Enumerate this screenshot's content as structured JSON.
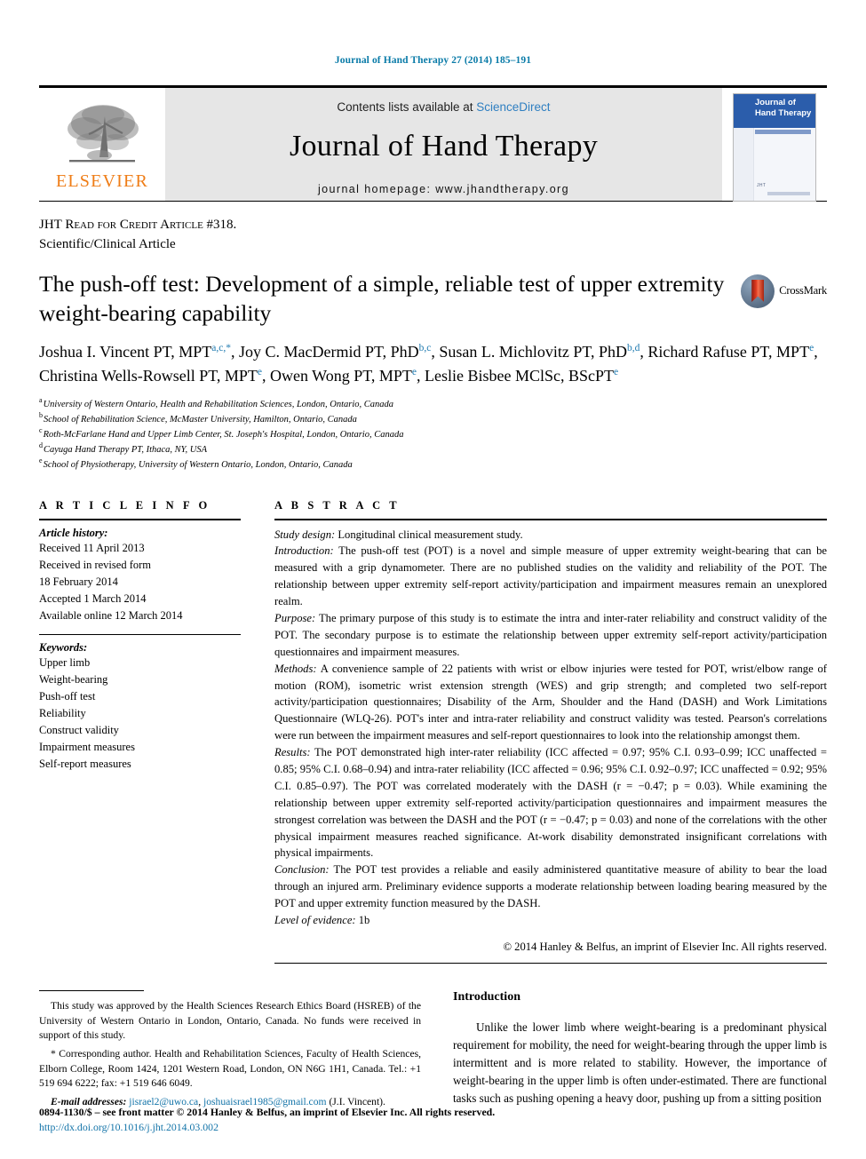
{
  "running_head": "Journal of Hand Therapy 27 (2014) 185–191",
  "masthead": {
    "publisher_name": "ELSEVIER",
    "contents_prefix": "Contents lists available at",
    "sciencedirect": "ScienceDirect",
    "journal_name": "Journal of Hand Therapy",
    "homepage": "journal homepage: www.jhandtherapy.org",
    "cover": {
      "title_line1": "Journal of",
      "title_line2": "Hand Therapy",
      "foot_mark": "JHT"
    }
  },
  "article_type": {
    "line1_prefix": "JHT",
    "line1_smallcaps": "Read for Credit Article #318.",
    "line2": "Scientific/Clinical Article"
  },
  "title": "The push-off test: Development of a simple, reliable test of upper extremity weight-bearing capability",
  "crossmark_label": "CrossMark",
  "authors": [
    {
      "name": "Joshua I. Vincent PT, MPT",
      "marks": "a,c,*",
      "sep": ", "
    },
    {
      "name": "Joy C. MacDermid PT, PhD",
      "marks": "b,c",
      "sep": ", "
    },
    {
      "name": "Susan L. Michlovitz PT, PhD",
      "marks": "b,d",
      "sep": ", "
    },
    {
      "name": "Richard Rafuse PT, MPT",
      "marks": "e",
      "sep": ", "
    },
    {
      "name": "Christina Wells-Rowsell PT, MPT",
      "marks": "e",
      "sep": ", "
    },
    {
      "name": "Owen Wong PT, MPT",
      "marks": "e",
      "sep": ", "
    },
    {
      "name": "Leslie Bisbee MClSc, BScPT",
      "marks": "e",
      "sep": ""
    }
  ],
  "affiliations": [
    {
      "key": "a",
      "text": "University of Western Ontario, Health and Rehabilitation Sciences, London, Ontario, Canada"
    },
    {
      "key": "b",
      "text": "School of Rehabilitation Science, McMaster University, Hamilton, Ontario, Canada"
    },
    {
      "key": "c",
      "text": "Roth-McFarlane Hand and Upper Limb Center, St. Joseph's Hospital, London, Ontario, Canada"
    },
    {
      "key": "d",
      "text": "Cayuga Hand Therapy PT, Ithaca, NY, USA"
    },
    {
      "key": "e",
      "text": "School of Physiotherapy, University of Western Ontario, London, Ontario, Canada"
    }
  ],
  "article_info": {
    "heading": "A R T I C L E   I N F O",
    "history_label": "Article history:",
    "history": [
      "Received 11 April 2013",
      "Received in revised form",
      "18 February 2014",
      "Accepted 1 March 2014",
      "Available online 12 March 2014"
    ],
    "keywords_label": "Keywords:",
    "keywords": [
      "Upper limb",
      "Weight-bearing",
      "Push-off test",
      "Reliability",
      "Construct validity",
      "Impairment measures",
      "Self-report measures"
    ]
  },
  "abstract": {
    "heading": "A B S T R A C T",
    "sections": [
      {
        "label": "Study design:",
        "text": " Longitudinal clinical measurement study."
      },
      {
        "label": "Introduction:",
        "text": " The push-off test (POT) is a novel and simple measure of upper extremity weight-bearing that can be measured with a grip dynamometer. There are no published studies on the validity and reliability of the POT. The relationship between upper extremity self-report activity/participation and impairment measures remain an unexplored realm."
      },
      {
        "label": "Purpose:",
        "text": " The primary purpose of this study is to estimate the intra and inter-rater reliability and construct validity of the POT. The secondary purpose is to estimate the relationship between upper extremity self-report activity/participation questionnaires and impairment measures."
      },
      {
        "label": "Methods:",
        "text": " A convenience sample of 22 patients with wrist or elbow injuries were tested for POT, wrist/elbow range of motion (ROM), isometric wrist extension strength (WES) and grip strength; and completed two self-report activity/participation questionnaires; Disability of the Arm, Shoulder and the Hand (DASH) and Work Limitations Questionnaire (WLQ-26). POT's inter and intra-rater reliability and construct validity was tested. Pearson's correlations were run between the impairment measures and self-report questionnaires to look into the relationship amongst them."
      },
      {
        "label": "Results:",
        "text": " The POT demonstrated high inter-rater reliability (ICC affected = 0.97; 95% C.I. 0.93–0.99; ICC unaffected = 0.85; 95% C.I. 0.68–0.94) and intra-rater reliability (ICC affected = 0.96; 95% C.I. 0.92–0.97; ICC unaffected = 0.92; 95% C.I. 0.85–0.97). The POT was correlated moderately with the DASH (r = −0.47; p = 0.03). While examining the relationship between upper extremity self-reported activity/participation questionnaires and impairment measures the strongest correlation was between the DASH and the POT (r = −0.47; p = 0.03) and none of the correlations with the other physical impairment measures reached significance. At-work disability demonstrated insignificant correlations with physical impairments."
      },
      {
        "label": "Conclusion:",
        "text": " The POT test provides a reliable and easily administered quantitative measure of ability to bear the load through an injured arm. Preliminary evidence supports a moderate relationship between loading bearing measured by the POT and upper extremity function measured by the DASH."
      },
      {
        "label": "Level of evidence:",
        "text": " 1b"
      }
    ],
    "copyright": "© 2014 Hanley & Belfus, an imprint of Elsevier Inc. All rights reserved."
  },
  "footnotes": {
    "ethics": "This study was approved by the Health Sciences Research Ethics Board (HSREB) of the University of Western Ontario in London, Ontario, Canada. No funds were received in support of this study.",
    "corresponding": "* Corresponding author. Health and Rehabilitation Sciences, Faculty of Health Sciences, Elborn College, Room 1424, 1201 Western Road, London, ON N6G 1H1, Canada. Tel.: +1 519 694 6222; fax: +1 519 646 6049.",
    "email_label": "E-mail addresses:",
    "email1": "jisrael2@uwo.ca",
    "email2": "joshuaisrael1985@gmail.com",
    "email_attrib": "(J.I. Vincent)."
  },
  "introduction": {
    "heading": "Introduction",
    "text": "Unlike the lower limb where weight-bearing is a predominant physical requirement for mobility, the need for weight-bearing through the upper limb is intermittent and is more related to stability. However, the importance of weight-bearing in the upper limb is often under-estimated. There are functional tasks such as pushing opening a heavy door, pushing up from a sitting position"
  },
  "footer": {
    "issn_line": "0894-1130/$ – see front matter © 2014 Hanley & Belfus, an imprint of Elsevier Inc. All rights reserved.",
    "doi": "http://dx.doi.org/10.1016/j.jht.2014.03.002"
  },
  "colors": {
    "link_blue": "#1273a8",
    "running_head_blue": "#0a7ba8",
    "elsevier_orange": "#ef7d17",
    "affiliation_mark_blue": "#1f7ab0",
    "cover_blue": "#2b5dab"
  }
}
